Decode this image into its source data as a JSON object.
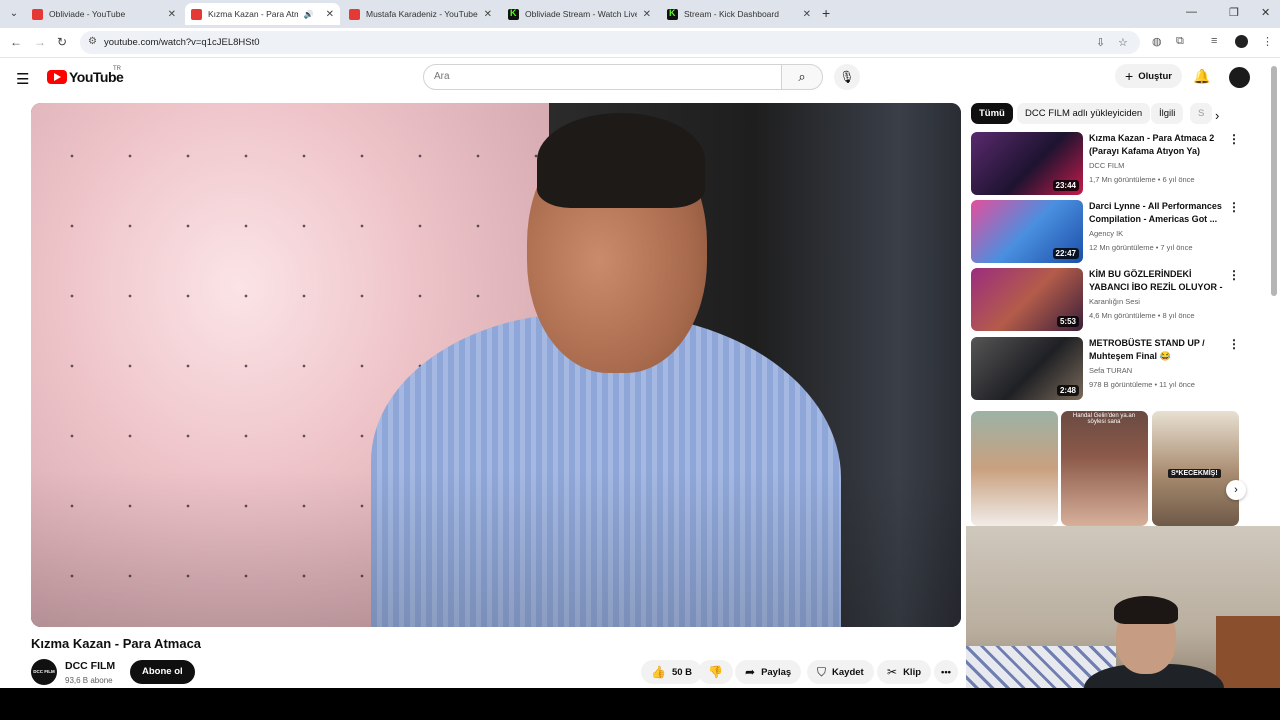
{
  "browser": {
    "tabs": [
      {
        "title": "Obliviade - YouTube",
        "favicon": "youtube-favicon"
      },
      {
        "title": "Kızma Kazan - Para Atmaca",
        "favicon": "youtube-favicon",
        "active": true,
        "audio": true
      },
      {
        "title": "Mustafa Karadeniz - YouTube",
        "favicon": "youtube-favicon"
      },
      {
        "title": "Obliviade Stream - Watch Live",
        "favicon": "kick-favicon"
      },
      {
        "title": "Stream - Kick Dashboard",
        "favicon": "kick-favicon"
      }
    ],
    "url": "youtube.com/watch?v=q1cJEL8HSt0"
  },
  "masthead": {
    "logo_text": "YouTube",
    "country": "TR",
    "search_placeholder": "Ara",
    "create_label": "Oluştur"
  },
  "video": {
    "title": "Kızma Kazan - Para Atmaca",
    "channel_name": "DCC FILM",
    "channel_avatar_text": "DCC FILM",
    "subscribers": "93,6 B abone",
    "subscribe_label": "Abone ol",
    "likes": "50 B",
    "share_label": "Paylaş",
    "save_label": "Kaydet",
    "clip_label": "Klip"
  },
  "chips": [
    "Tümü",
    "DCC FILM adlı yükleyiciden",
    "İlgili",
    "S"
  ],
  "related": [
    {
      "title": "Kızma Kazan - Para Atmaca 2 (Parayı Kafama Atıyon Ya)",
      "channel": "DCC FILM",
      "meta": "1,7 Mn görüntüleme • 6 yıl önce",
      "duration": "23:44",
      "thumb_color": "#3a1f3f"
    },
    {
      "title": "Darci Lynne - All Performances Compilation - Americas Got ...",
      "channel": "Agency IK",
      "meta": "12 Mn görüntüleme • 7 yıl önce",
      "duration": "22:47",
      "thumb_color": "#3c7ed0"
    },
    {
      "title": "KİM BU GÖZLERİNDEKİ YABANCI İBO REZİL OLUYOR - ...",
      "channel": "Karanlığın Sesi",
      "meta": "4,6 Mn görüntüleme • 8 yıl önce",
      "duration": "5:53",
      "thumb_color": "#7a2b6a"
    },
    {
      "title": "METROBÜSTE STAND UP / Muhteşem Final 😂",
      "channel": "Sefa TURAN",
      "meta": "978 B görüntüleme • 11 yıl önce",
      "duration": "2:48",
      "thumb_color": "#2d2f33"
    }
  ],
  "shorts": [
    {
      "overlay": "",
      "color": "#c9a07f"
    },
    {
      "overlay": "Handal Gelin'den ya.an söylesi sana",
      "color": "#8c5a4a"
    },
    {
      "overlay": "S*KECEKMİŞ!",
      "color": "#a88b6f"
    }
  ],
  "colors": {
    "accent": "#ff0000",
    "kick_green": "#53fc18"
  }
}
